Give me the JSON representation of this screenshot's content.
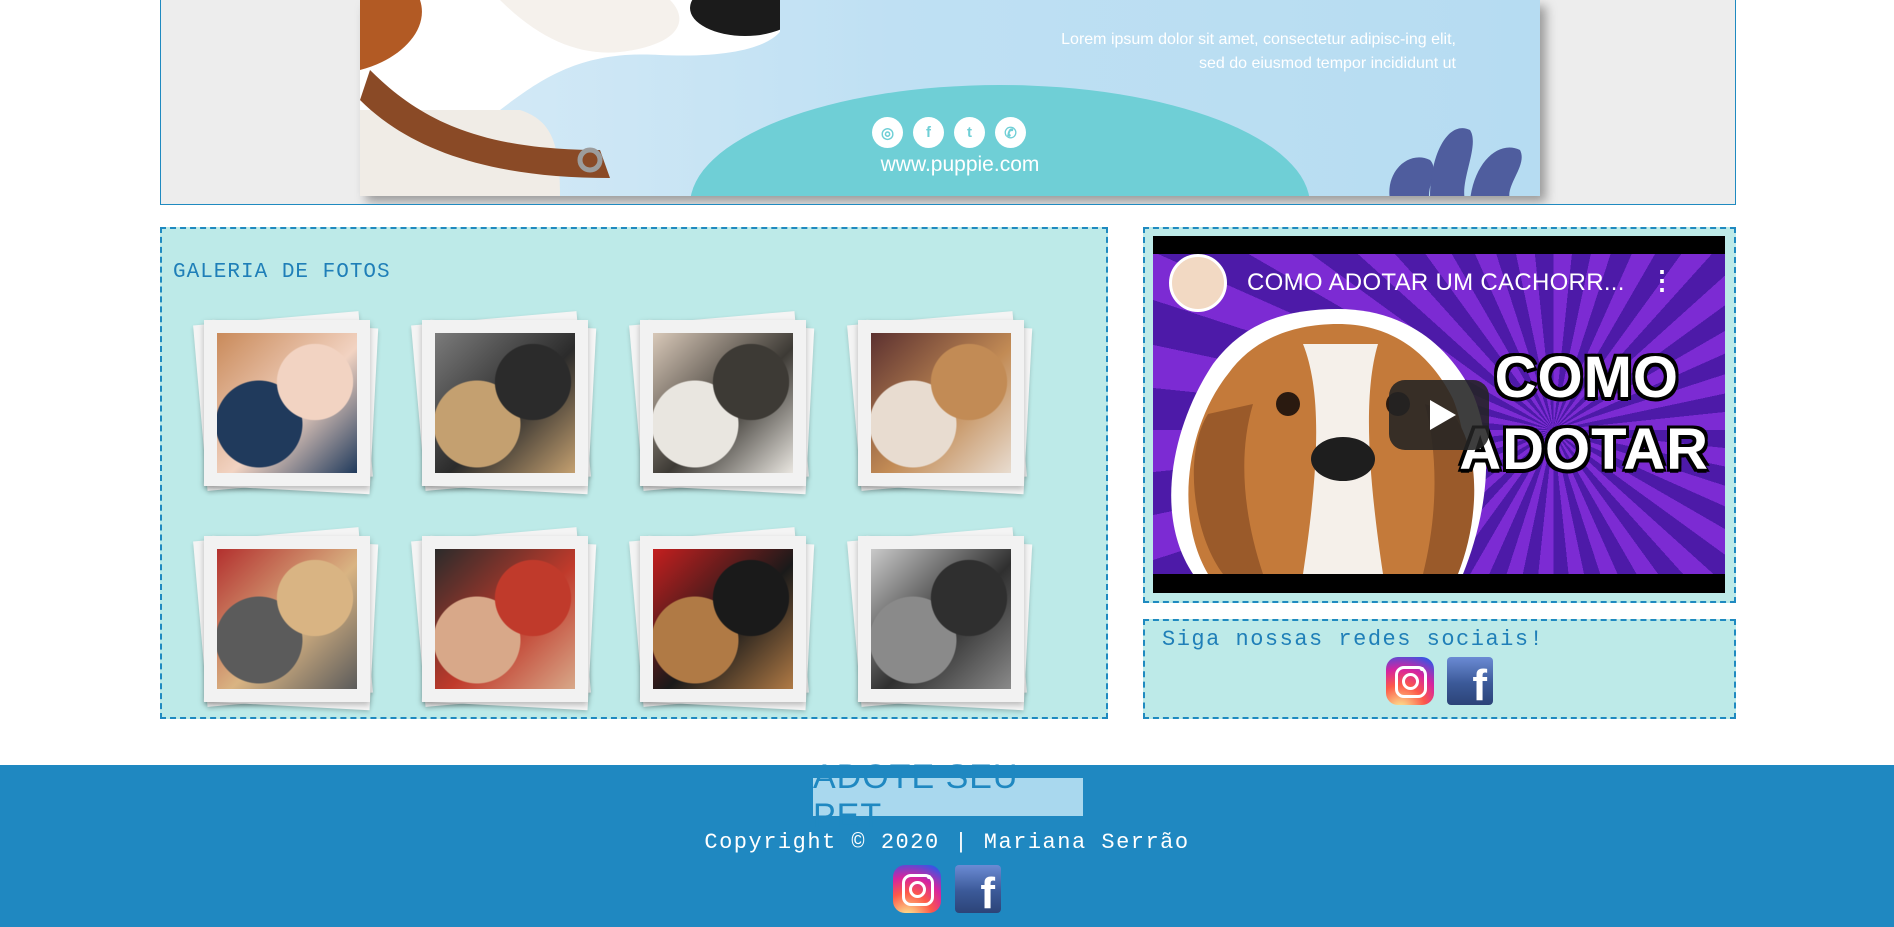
{
  "banner": {
    "text": "Lorem ipsum dolor sit amet, consectetur adipisc-ing elit, sed do eiusmod tempor incididunt ut",
    "social_icons": [
      "instagram-icon",
      "facebook-icon",
      "twitter-icon",
      "whatsapp-icon"
    ],
    "url": "www.puppie.com"
  },
  "gallery": {
    "title": "GALERIA DE FOTOS",
    "photos": [
      {
        "name": "photo-child-dog",
        "colors": [
          "#c98a5a",
          "#f2d3c2",
          "#203a5c"
        ]
      },
      {
        "name": "photo-woman-dog",
        "colors": [
          "#7b7b7b",
          "#2b2b2b",
          "#c4a070"
        ]
      },
      {
        "name": "photo-woman-cat",
        "colors": [
          "#d8c8b8",
          "#3d3a35",
          "#e9e6e0"
        ]
      },
      {
        "name": "photo-woman-dog-lying",
        "colors": [
          "#5c3130",
          "#c28b55",
          "#e8dcd0"
        ]
      },
      {
        "name": "photo-woman-beagle",
        "colors": [
          "#b3302e",
          "#d9b483",
          "#5b5b5b"
        ]
      },
      {
        "name": "photo-couple-dogs",
        "colors": [
          "#2b2b2b",
          "#c03a2b",
          "#d8a889"
        ]
      },
      {
        "name": "photo-woman-two-dogs",
        "colors": [
          "#c41f1f",
          "#1a1a1a",
          "#b07a45"
        ]
      },
      {
        "name": "photo-couple-kittens",
        "colors": [
          "#c9c9c9",
          "#2f2f2f",
          "#8a8a8a"
        ]
      }
    ]
  },
  "video": {
    "title": "COMO ADOTAR UM CACHORR...",
    "caption_line1": "COMO",
    "caption_line2": "ADOTAR"
  },
  "socials": {
    "title": "Siga nossas redes sociais!",
    "icons": [
      "instagram-icon",
      "facebook-icon"
    ]
  },
  "footer": {
    "logo_text": "ADOTE SEU PET",
    "copyright": "Copyright © 2020 | Mariana Serrão"
  },
  "colors": {
    "accent_blue": "#1f88c1",
    "panel_bg": "#bdeae8",
    "title_blue": "#1f7fb8"
  }
}
